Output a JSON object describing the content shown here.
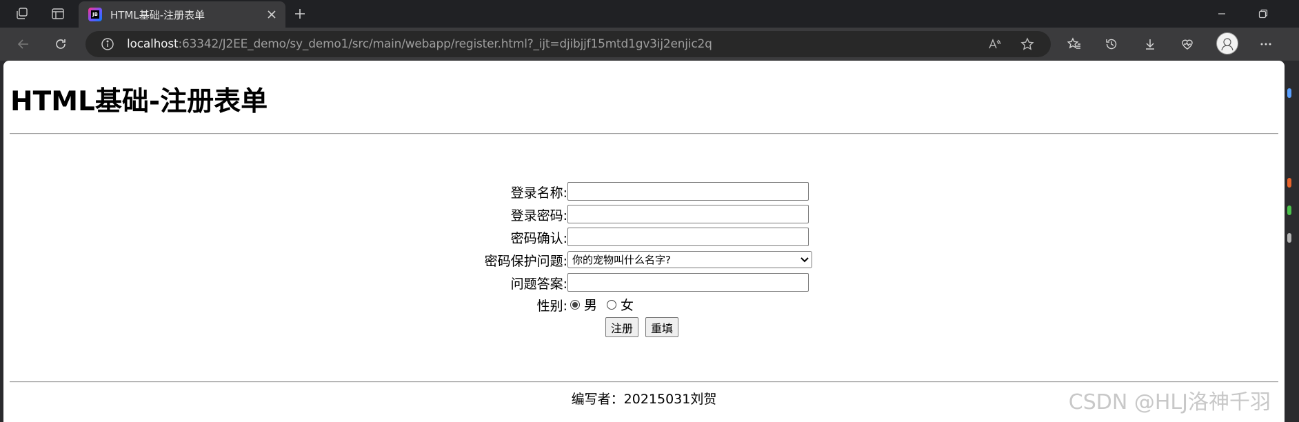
{
  "browser": {
    "tab": {
      "title": "HTML基础-注册表单",
      "favicon": "jetbrains-icon"
    },
    "address": {
      "host": "localhost",
      "rest": ":63342/J2EE_demo/sy_demo1/src/main/webapp/register.html?_ijt=djibjjf15mtd1gv3ij2enjic2q"
    }
  },
  "page": {
    "title": "HTML基础-注册表单",
    "form": {
      "login_name_label": "登录名称:",
      "login_name_value": "",
      "password_label": "登录密码:",
      "password_value": "",
      "confirm_label": "密码确认:",
      "confirm_value": "",
      "question_label": "密码保护问题:",
      "question_selected": "你的宠物叫什么名字?",
      "answer_label": "问题答案:",
      "answer_value": "",
      "gender_label": "性别:",
      "gender_options": [
        "男",
        "女"
      ],
      "gender_selected": "男",
      "submit_label": "注册",
      "reset_label": "重填"
    },
    "footer": "编写者：20215031刘贺",
    "watermark": "CSDN @HLJ洛神千羽"
  },
  "colors": {
    "titlebar": "#202124",
    "toolbar": "#3b3b3d",
    "address_bg": "#282828",
    "page_bg": "#ffffff"
  }
}
